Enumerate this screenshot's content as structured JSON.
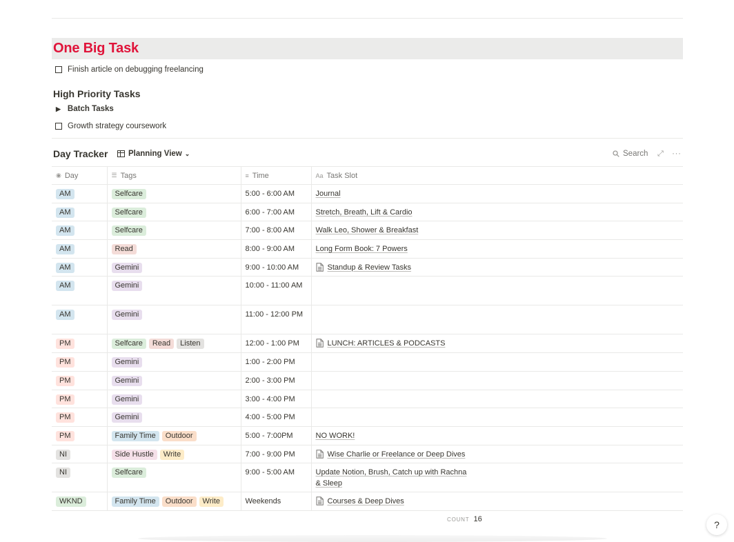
{
  "big_task": {
    "title": "One Big Task",
    "todo_label": "Finish article on debugging freelancing"
  },
  "high_priority": {
    "heading": "High Priority Tasks",
    "toggle_label": "Batch Tasks",
    "todo_label": "Growth strategy coursework"
  },
  "tracker": {
    "title": "Day Tracker",
    "view_label": "Planning View",
    "search_label": "Search",
    "columns": [
      "Day",
      "Tags",
      "Time",
      "Task Slot"
    ],
    "count_label": "COUNT",
    "count_value": "16",
    "rows": [
      {
        "day": "AM",
        "tags": [
          "Selfcare"
        ],
        "time": "5:00 - 6:00 AM",
        "slot": "Journal",
        "doc": false
      },
      {
        "day": "AM",
        "tags": [
          "Selfcare"
        ],
        "time": "6:00 - 7:00 AM",
        "slot": "Stretch, Breath, Lift & Cardio",
        "doc": false
      },
      {
        "day": "AM",
        "tags": [
          "Selfcare"
        ],
        "time": "7:00 - 8:00 AM",
        "slot": "Walk Leo, Shower & Breakfast",
        "doc": false
      },
      {
        "day": "AM",
        "tags": [
          "Read"
        ],
        "time": "8:00 - 9:00 AM",
        "slot": "Long Form Book: 7 Powers",
        "doc": false
      },
      {
        "day": "AM",
        "tags": [
          "Gemini"
        ],
        "time": "9:00 - 10:00 AM",
        "slot": "Standup & Review Tasks",
        "doc": true
      },
      {
        "day": "AM",
        "tags": [
          "Gemini"
        ],
        "time": "10:00 - 11:00 AM",
        "slot": "",
        "doc": false
      },
      {
        "day": "AM",
        "tags": [
          "Gemini"
        ],
        "time": "11:00 - 12:00 PM",
        "slot": "",
        "doc": false
      },
      {
        "day": "PM",
        "tags": [
          "Selfcare",
          "Read",
          "Listen"
        ],
        "time": "12:00 - 1:00 PM",
        "slot": "LUNCH: ARTICLES & PODCASTS",
        "doc": true
      },
      {
        "day": "PM",
        "tags": [
          "Gemini"
        ],
        "time": "1:00 - 2:00 PM",
        "slot": "",
        "doc": false
      },
      {
        "day": "PM",
        "tags": [
          "Gemini"
        ],
        "time": "2:00 - 3:00 PM",
        "slot": "",
        "doc": false
      },
      {
        "day": "PM",
        "tags": [
          "Gemini"
        ],
        "time": "3:00 - 4:00 PM",
        "slot": "",
        "doc": false
      },
      {
        "day": "PM",
        "tags": [
          "Gemini"
        ],
        "time": "4:00 - 5:00 PM",
        "slot": "",
        "doc": false
      },
      {
        "day": "PM",
        "tags": [
          "Family Time",
          "Outdoor"
        ],
        "time": "5:00 - 7:00PM",
        "slot": "NO WORK!",
        "doc": false
      },
      {
        "day": "NI",
        "tags": [
          "Side Hustle",
          "Write"
        ],
        "time": "7:00 - 9:00 PM",
        "slot": "Wise Charlie or Freelance or Deep Dives",
        "doc": true
      },
      {
        "day": "NI",
        "tags": [
          "Selfcare"
        ],
        "time": "9:00 - 5:00 AM",
        "slot": "Update Notion, Brush, Catch up with Rachna & Sleep",
        "doc": false
      },
      {
        "day": "WKND",
        "tags": [
          "Family Time",
          "Outdoor",
          "Write"
        ],
        "time": "Weekends",
        "slot": "Courses & Deep Dives",
        "doc": true
      }
    ]
  },
  "colors": {
    "title_red": "#e0143a",
    "day_AM": "#d3e5ef",
    "day_PM": "#ffe2dd",
    "day_NI": "#e3e2e0",
    "day_WKND": "#dbeddb",
    "tag_Selfcare": "#dbeddb",
    "tag_Read": "#f4dcd8",
    "tag_Listen": "#e3e2e0",
    "tag_Gemini": "#e8deee",
    "tag_Family Time": "#d3e5ef",
    "tag_Outdoor": "#fadec9",
    "tag_Side Hustle": "#f5e0e9",
    "tag_Write": "#fdecc8"
  },
  "help": {
    "label": "?"
  }
}
